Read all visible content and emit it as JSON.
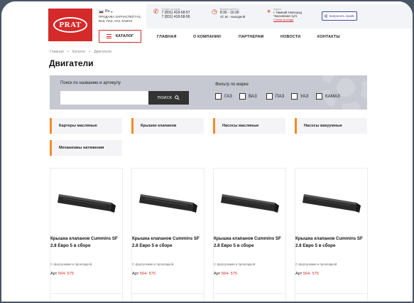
{
  "brand": {
    "logo_text": "PRAT",
    "lang": "Ru",
    "tagline": "ПРОДАЖА ЗАПЧАСТЕЙ ГАЗ, ВАЗ, ПАЗ, УАЗ, КАМАЗ"
  },
  "header": {
    "calls_label": "Отдел продаж",
    "phone1": "7 (831) 418-58-57",
    "phone2": "7 (831) 418-58-56",
    "hours_label": "Время работы",
    "hours": "8:30 - 16:30",
    "hours_off": "сб, вс - выходной",
    "address_label": "Адрес",
    "address": "г. Нижний Новгород Чкаловская 1у/1",
    "map_link": "Схема проезда",
    "request_button": "Запросить прайс",
    "catalog_button": "КАТАЛОГ"
  },
  "nav": [
    "ГЛАВНАЯ",
    "О КОМПАНИИ",
    "ПАРТНЕРАМ",
    "НОВОСТИ",
    "КОНТАКТЫ"
  ],
  "breadcrumb": [
    "Главная",
    "Каталог",
    "Двигатели"
  ],
  "page_title": "Двигатели",
  "filter": {
    "search_label": "Поиск по названию и артикулу",
    "search_value": "",
    "search_button": "ПОИСК",
    "brand_label": "Фильтр по марке",
    "brands": [
      "ГАЗ",
      "ВАЗ",
      "ПАЗ",
      "УАЗ",
      "КАМАЗ"
    ]
  },
  "categories": [
    "Картеры масляные",
    "Крышки клапанов",
    "Насосы масляные",
    "Насосы вакуумные",
    "Механизмы натяжения"
  ],
  "products": [
    {
      "title": "Крышка клапанов Cummins SF 2.8 Евро 5 в сборе",
      "desc": "С форсунками и прокладкой",
      "art_label": "Арт",
      "art": "564- 575"
    },
    {
      "title": "Крышка клапанов Cummins SF 2.8 Евро 5 в сборе",
      "desc": "С форсунками и прокладкой",
      "art_label": "Арт",
      "art": "564- 575"
    },
    {
      "title": "Крышка клапанов Cummins SF 2.8 Евро 5 в сборе",
      "desc": "С форсунками и прокладкой",
      "art_label": "Арт",
      "art": "564- 575"
    },
    {
      "title": "Крышка клапанов Cummins SF 2.8 Евро 5 в сборе",
      "desc": "С форсунками и прокладкой",
      "art_label": "Арт",
      "art": "564- 575"
    }
  ],
  "colors": {
    "accent": "#d42a2a",
    "category_marker": "#f28c28",
    "filter_bg": "#c6c9d2"
  }
}
